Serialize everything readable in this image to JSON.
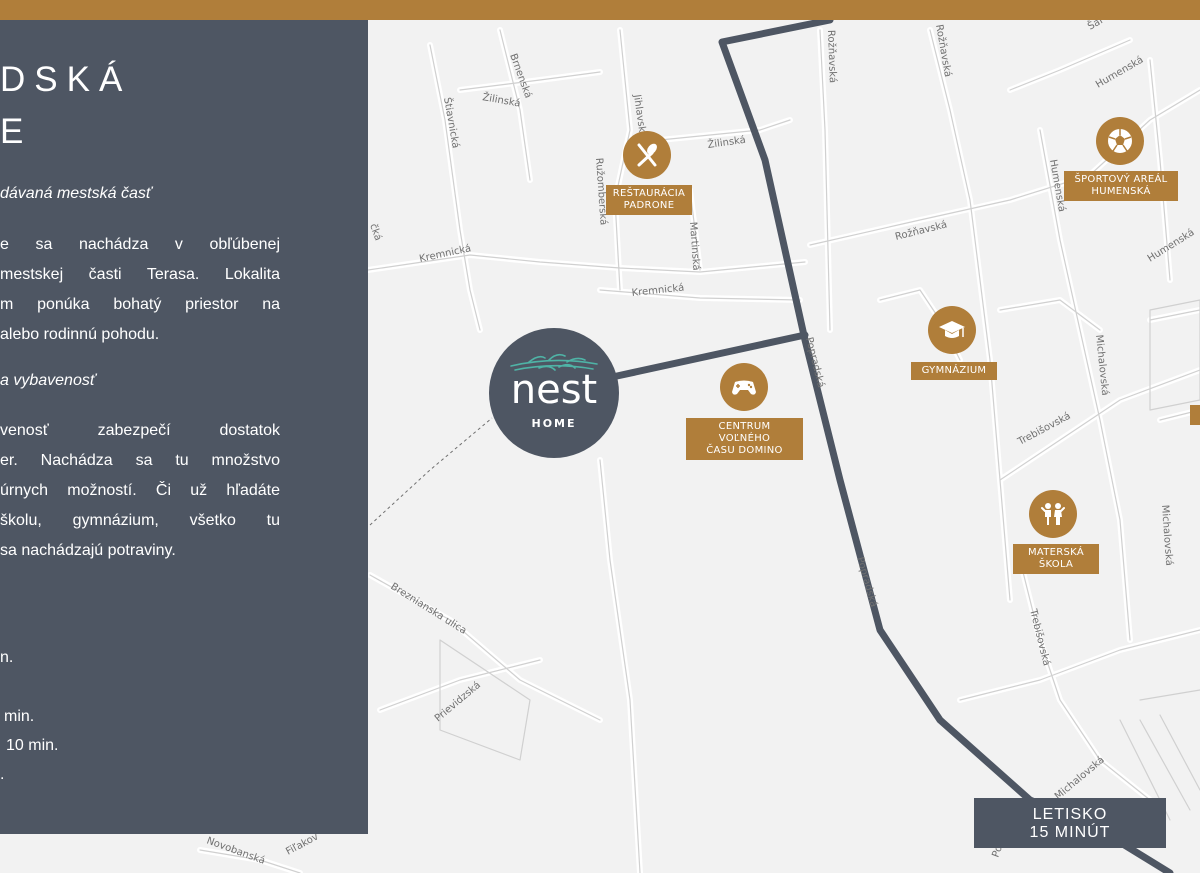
{
  "colors": {
    "accent": "#b07e3a",
    "panel": "#4e5663",
    "road": "#4e5663",
    "map_bg": "#f2f2f2"
  },
  "panel": {
    "title_line1": "DSKÁ",
    "title_line2": "E",
    "subheading1": "dávaná mestská časť",
    "para1": [
      "e sa nachádza v obľúbenej",
      "mestskej časti Terasa. Lokalita",
      "m ponúka bohatý priestor na",
      "alebo rodinnú pohodu."
    ],
    "subheading2": "a vybavenosť",
    "para2": [
      "venosť zabezpečí dostatok",
      "er. Nachádza sa tu množstvo",
      "úrnych možností. Či už hľadáte",
      "školu, gymnázium, všetko tu",
      "sa nachádzajú potraviny."
    ],
    "distances": [
      "n.",
      "min.",
      "10 min.",
      "."
    ]
  },
  "streets": {
    "brnenska": "Brnenská",
    "zilinska1": "Žilinská",
    "stiavnicka": "Štiavnická",
    "jihlavska": "Jihlavská",
    "zilinska2": "Žilinská",
    "roznavska1": "Rožňavská",
    "roznavska2": "Rožňavská",
    "roznavska3": "Rožňavská",
    "humenska1": "Humenská",
    "humenska2": "Humenská",
    "humenska3": "Humenská",
    "sat": "Šaf",
    "ruzomberska": "Ružomberská",
    "martinska": "Martinská",
    "kremnicka1": "Kremnická",
    "kremnicka2": "Kremnická",
    "lecka": "čká",
    "michalovska1": "Michalovská",
    "michalovska2": "Michalovská",
    "michalovska3": "Michalovská",
    "trebisovska1": "Trebišovská",
    "trebisovska2": "Trebišovská",
    "breznianska": "Breznianska ulica",
    "prievidzska": "Prievidzská",
    "novobanska": "Novobanská",
    "filakovska": "Fiľakov",
    "popradska1": "Popradská",
    "popradska2": "Popradská",
    "po": "Po"
  },
  "pois": [
    {
      "name": "restaurant",
      "icon": "fork-knife-icon",
      "label": [
        "REŠTAURÁCIA",
        "PADRONE"
      ]
    },
    {
      "name": "sports",
      "icon": "soccer-ball-icon",
      "label": [
        "ŠPORTOVÝ AREÁL",
        "HUMENSKÁ"
      ]
    },
    {
      "name": "gymnazium",
      "icon": "graduation-cap-icon",
      "label": [
        "GYMNÁZIUM"
      ]
    },
    {
      "name": "domino",
      "icon": "game-controller-icon",
      "label": [
        "CENTRUM VOĽNÉHO",
        "ČASU DOMINO"
      ]
    },
    {
      "name": "kindergarten",
      "icon": "children-icon",
      "label": [
        "MATERSKÁ",
        "ŠKOLA"
      ]
    }
  ],
  "logo": {
    "word": "nest",
    "sub": "HOME"
  },
  "airport": {
    "line1": "LETISKO",
    "line2": "15 MINÚT"
  }
}
